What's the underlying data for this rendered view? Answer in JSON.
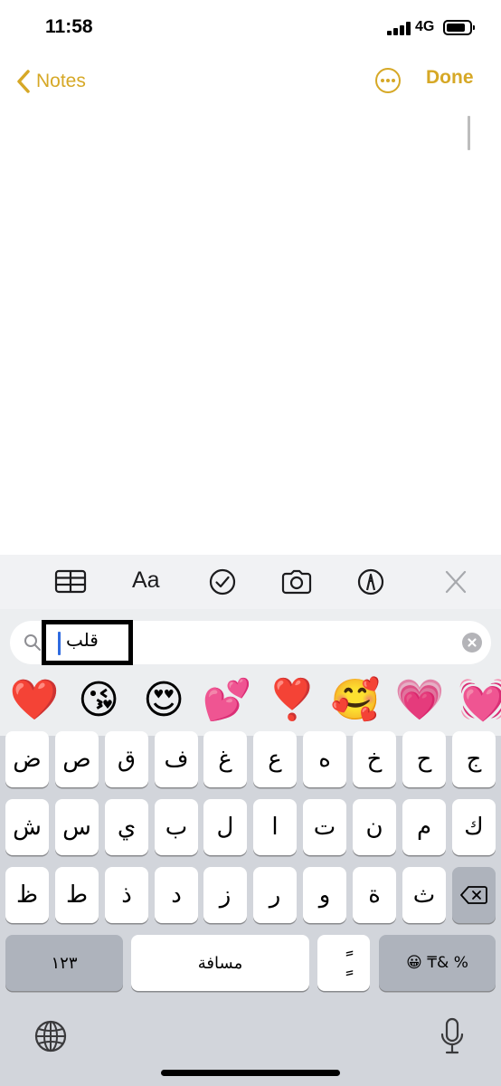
{
  "status": {
    "time": "11:58",
    "network": "4G",
    "battery_level": 0.85
  },
  "nav": {
    "back_label": "Notes",
    "done_label": "Done"
  },
  "toolbar": {
    "format_label": "Aa"
  },
  "search": {
    "value": "قلب"
  },
  "emojis": [
    "❤️",
    "😘",
    "😍",
    "💕",
    "❣️",
    "🥰",
    "💗",
    "💓"
  ],
  "keyboard": {
    "row1": [
      "ج",
      "ح",
      "خ",
      "ه",
      "ع",
      "غ",
      "ف",
      "ق",
      "ص",
      "ض"
    ],
    "row2": [
      "ك",
      "م",
      "ن",
      "ت",
      "ا",
      "ل",
      "ب",
      "ي",
      "س",
      "ش"
    ],
    "row3": [
      "ث",
      "ة",
      "و",
      "ر",
      "ز",
      "د",
      "ذ",
      "ط",
      "ظ"
    ],
    "numbers_label": "١٢٣",
    "space_label": "مسافة",
    "diacritic_label": "ًٍ",
    "symbols_label": "😀 ₸& %"
  },
  "colors": {
    "accent": "#d6a826",
    "keyboard_bg": "#d2d5db",
    "cursor": "#2f6be0"
  },
  "icons": [
    "table-icon",
    "checklist-icon",
    "camera-icon",
    "markup-icon",
    "close-icon",
    "globe-icon",
    "microphone-icon",
    "delete-key-icon",
    "search-icon"
  ]
}
